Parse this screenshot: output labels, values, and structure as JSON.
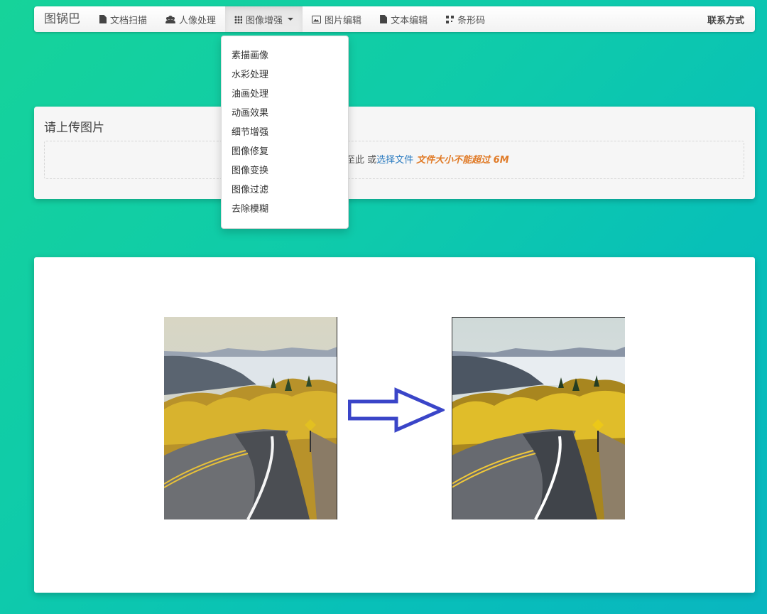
{
  "navbar": {
    "brand": "图锅巴",
    "items": [
      {
        "label": "文档扫描",
        "icon": "document-icon"
      },
      {
        "label": "人像处理",
        "icon": "users-icon"
      },
      {
        "label": "图像增强",
        "icon": "grid-icon"
      },
      {
        "label": "图片编辑",
        "icon": "image-icon"
      },
      {
        "label": "文本编辑",
        "icon": "text-document-icon"
      },
      {
        "label": "条形码",
        "icon": "qrcode-icon"
      }
    ],
    "contact": "联系方式"
  },
  "dropdown": {
    "items": [
      "素描画像",
      "水彩处理",
      "油画处理",
      "动画效果",
      "细节增强",
      "图像修复",
      "图像变换",
      "图像过滤",
      "去除模糊"
    ]
  },
  "upload": {
    "title": "请上传图片",
    "drop_text": "拽至此 或",
    "select_link": "选择文件",
    "size_warning": "文件大小不能超过 6M"
  },
  "demo": {
    "before_image": "landscape-road-photo",
    "after_image": "landscape-road-photo-enhanced",
    "arrow_color": "#3a45c8"
  }
}
